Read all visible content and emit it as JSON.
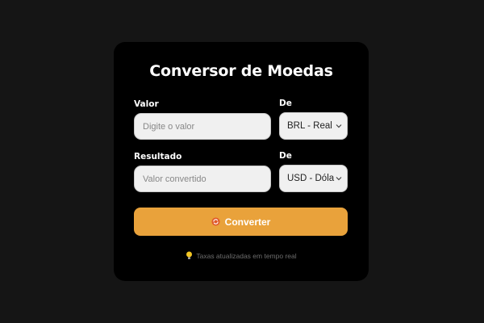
{
  "card": {
    "title": "Conversor de Moedas"
  },
  "form": {
    "value_label": "Valor",
    "value_placeholder": "Digite o valor",
    "from_label": "De",
    "from_selected": "BRL - Real",
    "result_label": "Resultado",
    "result_placeholder": "Valor convertido",
    "to_label": "De",
    "to_selected": "USD - Dóla"
  },
  "action": {
    "convert_label": "Converter",
    "convert_icon": "refresh-icon"
  },
  "footer": {
    "note": "Taxas atualizadas em tempo real",
    "note_icon": "lightbulb-icon"
  },
  "colors": {
    "background": "#151515",
    "card": "#000000",
    "accent": "#e9a23b"
  }
}
